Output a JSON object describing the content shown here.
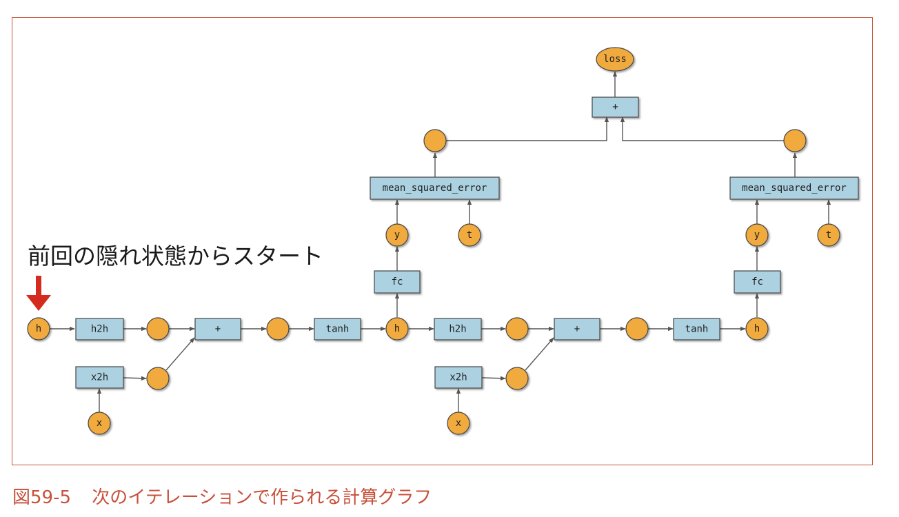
{
  "annotation": {
    "text": "前回の隠れ状態からスタート"
  },
  "caption": {
    "number": "図59-5",
    "title": "次のイテレーションで作られる計算グラフ"
  },
  "colors": {
    "variable_fill": "#f0aa3c",
    "function_fill": "#acd2e2",
    "edge": "#555555",
    "arrow_marker": "#d52a1e",
    "caption": "#c8503a",
    "frame": "#c8503a"
  },
  "graph": {
    "labels": {
      "loss": "loss",
      "add_loss": "+",
      "mse_left": "mean_squared_error",
      "mse_right": "mean_squared_error",
      "y_left": "y",
      "y_right": "y",
      "t_left": "t",
      "t_right": "t",
      "fc_left": "fc",
      "fc_right": "fc",
      "h0": "h",
      "h1": "h",
      "h2": "h",
      "h2h_1": "h2h",
      "h2h_2": "h2h",
      "add_1": "+",
      "add_2": "+",
      "tanh_1": "tanh",
      "tanh_2": "tanh",
      "x2h_1": "x2h",
      "x2h_2": "x2h",
      "x_1": "x",
      "x_2": "x"
    }
  }
}
